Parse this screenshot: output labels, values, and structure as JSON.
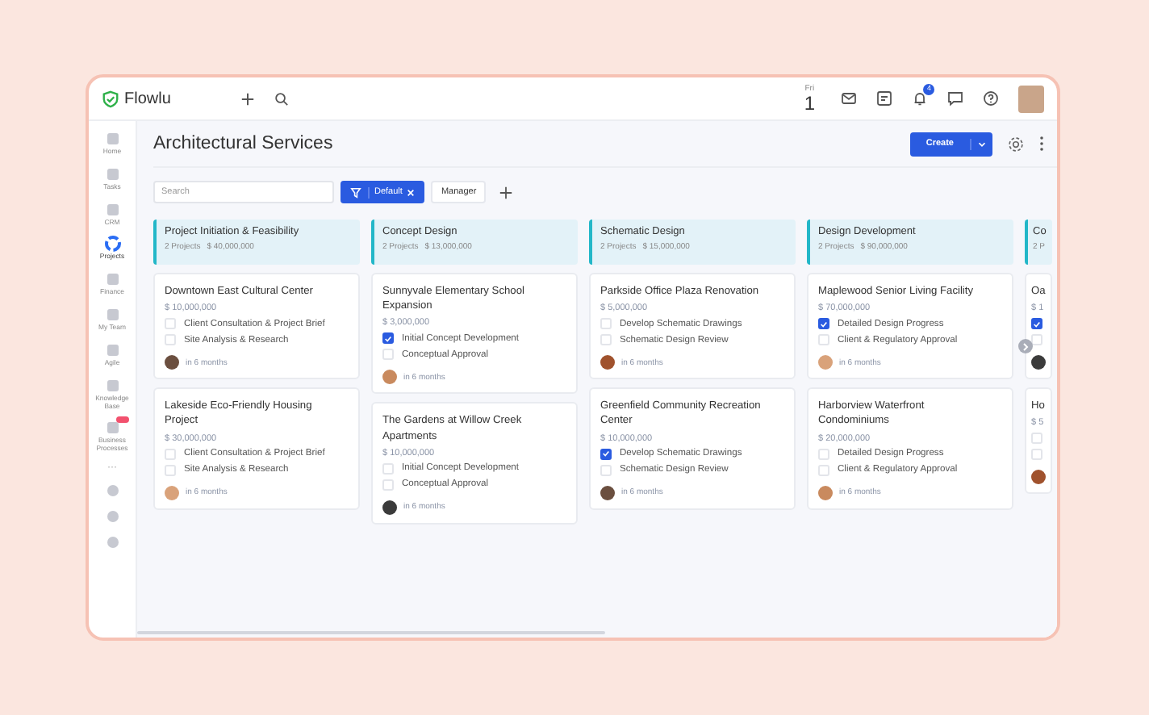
{
  "app": {
    "name": "Flowlu"
  },
  "topbar": {
    "day": "Fri",
    "date": "1",
    "notification_count": "4"
  },
  "sidebar": {
    "items": [
      {
        "label": "Home",
        "selected": false
      },
      {
        "label": "Tasks",
        "selected": false
      },
      {
        "label": "CRM",
        "selected": false
      },
      {
        "label": "Projects",
        "selected": true
      },
      {
        "label": "Finance",
        "selected": false
      },
      {
        "label": "My Team",
        "selected": false
      },
      {
        "label": "Agile",
        "selected": false
      },
      {
        "label": "Knowledge Base",
        "selected": false
      },
      {
        "label": "Business Processes",
        "selected": false,
        "badge": true
      }
    ],
    "more": "···"
  },
  "page": {
    "title": "Architectural Services",
    "create_button": "Create"
  },
  "toolbar": {
    "search": {
      "placeholder": "Search"
    },
    "filters": [
      {
        "label": "Default",
        "selected": true
      },
      {
        "label": "Manager",
        "selected": false
      }
    ]
  },
  "columns": [
    {
      "title": "Project Initiation & Feasibility",
      "count": "2 Projects",
      "total": "$ 40,000,000",
      "cards": [
        {
          "title": "Downtown East Cultural Center",
          "amount": "$ 10,000,000",
          "tasks": [
            {
              "label": "Client Consultation & Project Brief",
              "checked": false
            },
            {
              "label": "Site Analysis & Research",
              "checked": false
            }
          ],
          "due": "in 6 months"
        },
        {
          "title": "Lakeside Eco-Friendly Housing Project",
          "amount": "$ 30,000,000",
          "tasks": [
            {
              "label": "Client Consultation & Project Brief",
              "checked": false
            },
            {
              "label": "Site Analysis & Research",
              "checked": false
            }
          ],
          "due": "in 6 months"
        }
      ]
    },
    {
      "title": "Concept Design",
      "count": "2 Projects",
      "total": "$ 13,000,000",
      "cards": [
        {
          "title": "Sunnyvale Elementary School Expansion",
          "amount": "$ 3,000,000",
          "tasks": [
            {
              "label": "Initial Concept Development",
              "checked": true
            },
            {
              "label": "Conceptual Approval",
              "checked": false
            }
          ],
          "due": "in 6 months"
        },
        {
          "title": "The Gardens at Willow Creek Apartments",
          "amount": "$ 10,000,000",
          "tasks": [
            {
              "label": "Initial Concept Development",
              "checked": false
            },
            {
              "label": "Conceptual Approval",
              "checked": false
            }
          ],
          "due": "in 6 months"
        }
      ]
    },
    {
      "title": "Schematic Design",
      "count": "2 Projects",
      "total": "$ 15,000,000",
      "cards": [
        {
          "title": "Parkside Office Plaza Renovation",
          "amount": "$ 5,000,000",
          "tasks": [
            {
              "label": "Develop Schematic Drawings",
              "checked": false
            },
            {
              "label": "Schematic Design Review",
              "checked": false
            }
          ],
          "due": "in 6 months"
        },
        {
          "title": "Greenfield Community Recreation Center",
          "amount": "$ 10,000,000",
          "tasks": [
            {
              "label": "Develop Schematic Drawings",
              "checked": true
            },
            {
              "label": "Schematic Design Review",
              "checked": false
            }
          ],
          "due": "in 6 months"
        }
      ]
    },
    {
      "title": "Design Development",
      "count": "2 Projects",
      "total": "$ 90,000,000",
      "cards": [
        {
          "title": "Maplewood Senior Living Facility",
          "amount": "$ 70,000,000",
          "tasks": [
            {
              "label": "Detailed Design Progress",
              "checked": true
            },
            {
              "label": "Client & Regulatory Approval",
              "checked": false
            }
          ],
          "due": "in 6 months"
        },
        {
          "title": "Harborview Waterfront Condominiums",
          "amount": "$ 20,000,000",
          "tasks": [
            {
              "label": "Detailed Design Progress",
              "checked": false
            },
            {
              "label": "Client & Regulatory Approval",
              "checked": false
            }
          ],
          "due": "in 6 months"
        }
      ]
    },
    {
      "title": "Co",
      "count": "2 P",
      "cards": [
        {
          "title": "Oa",
          "amount": "$ 1",
          "tasks": [
            {
              "checked": true
            },
            {
              "checked": false
            }
          ]
        },
        {
          "title": "Ho",
          "amount": "$ 5",
          "tasks": [
            {
              "checked": false
            },
            {
              "checked": false
            }
          ]
        }
      ]
    }
  ]
}
